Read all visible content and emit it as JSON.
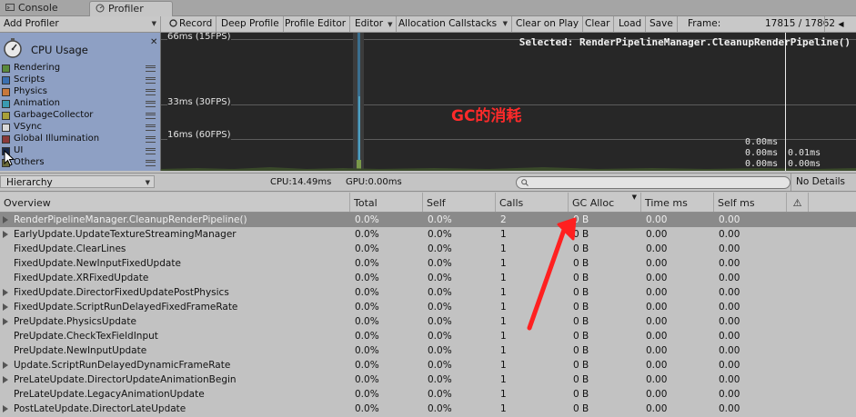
{
  "tabs": {
    "console": "Console",
    "profiler": "Profiler"
  },
  "toolbar": {
    "add_profiler": "Add Profiler",
    "record": "Record",
    "deep_profile": "Deep Profile",
    "profile_editor": "Profile Editor",
    "editor": "Editor",
    "allocation_callstacks": "Allocation Callstacks",
    "clear_on_play": "Clear on Play",
    "clear": "Clear",
    "load": "Load",
    "save": "Save",
    "frame_label": "Frame:",
    "frame_value": "17815 / 17862"
  },
  "cpu_panel": {
    "title": "CPU Usage",
    "legend": [
      {
        "label": "Rendering",
        "color": "#5a8a3c"
      },
      {
        "label": "Scripts",
        "color": "#3a6fb0"
      },
      {
        "label": "Physics",
        "color": "#c8783a"
      },
      {
        "label": "Animation",
        "color": "#3a9ab0"
      },
      {
        "label": "GarbageCollector",
        "color": "#a8a03a"
      },
      {
        "label": "VSync",
        "color": "#d8d8d8"
      },
      {
        "label": "Global Illumination",
        "color": "#8a3a3a"
      },
      {
        "label": "UI",
        "color": "#1a2a4a"
      },
      {
        "label": "Others",
        "color": "#6a6a3a"
      }
    ]
  },
  "graph": {
    "labels": [
      "66ms (15FPS)",
      "33ms (30FPS)",
      "16ms (60FPS)"
    ],
    "selected": "Selected: RenderPipelineManager.CleanupRenderPipeline()",
    "annotation": "GC的消耗",
    "values_left": [
      "0.00ms",
      "0.00ms",
      "0.00ms"
    ],
    "values_right": [
      "0.01ms",
      "0.00ms"
    ]
  },
  "details_bar": {
    "view": "Hierarchy",
    "cpu": "CPU:14.49ms",
    "gpu": "GPU:0.00ms",
    "search_placeholder": "",
    "no_details": "No Details"
  },
  "table": {
    "columns": [
      "Overview",
      "Total",
      "Self",
      "Calls",
      "GC Alloc",
      "Time ms",
      "Self ms",
      "⚠"
    ],
    "rows": [
      {
        "name": "RenderPipelineManager.CleanupRenderPipeline()",
        "total": "0.0%",
        "self": "0.0%",
        "calls": "2",
        "gc": "0 B",
        "time": "0.00",
        "selfms": "0.00",
        "expand": true,
        "selected": true
      },
      {
        "name": "EarlyUpdate.UpdateTextureStreamingManager",
        "total": "0.0%",
        "self": "0.0%",
        "calls": "1",
        "gc": "0 B",
        "time": "0.00",
        "selfms": "0.00",
        "expand": true
      },
      {
        "name": "FixedUpdate.ClearLines",
        "total": "0.0%",
        "self": "0.0%",
        "calls": "1",
        "gc": "0 B",
        "time": "0.00",
        "selfms": "0.00",
        "expand": false
      },
      {
        "name": "FixedUpdate.NewInputFixedUpdate",
        "total": "0.0%",
        "self": "0.0%",
        "calls": "1",
        "gc": "0 B",
        "time": "0.00",
        "selfms": "0.00",
        "expand": false
      },
      {
        "name": "FixedUpdate.XRFixedUpdate",
        "total": "0.0%",
        "self": "0.0%",
        "calls": "1",
        "gc": "0 B",
        "time": "0.00",
        "selfms": "0.00",
        "expand": false
      },
      {
        "name": "FixedUpdate.DirectorFixedUpdatePostPhysics",
        "total": "0.0%",
        "self": "0.0%",
        "calls": "1",
        "gc": "0 B",
        "time": "0.00",
        "selfms": "0.00",
        "expand": true
      },
      {
        "name": "FixedUpdate.ScriptRunDelayedFixedFrameRate",
        "total": "0.0%",
        "self": "0.0%",
        "calls": "1",
        "gc": "0 B",
        "time": "0.00",
        "selfms": "0.00",
        "expand": true
      },
      {
        "name": "PreUpdate.PhysicsUpdate",
        "total": "0.0%",
        "self": "0.0%",
        "calls": "1",
        "gc": "0 B",
        "time": "0.00",
        "selfms": "0.00",
        "expand": true
      },
      {
        "name": "PreUpdate.CheckTexFieldInput",
        "total": "0.0%",
        "self": "0.0%",
        "calls": "1",
        "gc": "0 B",
        "time": "0.00",
        "selfms": "0.00",
        "expand": false
      },
      {
        "name": "PreUpdate.NewInputUpdate",
        "total": "0.0%",
        "self": "0.0%",
        "calls": "1",
        "gc": "0 B",
        "time": "0.00",
        "selfms": "0.00",
        "expand": false
      },
      {
        "name": "Update.ScriptRunDelayedDynamicFrameRate",
        "total": "0.0%",
        "self": "0.0%",
        "calls": "1",
        "gc": "0 B",
        "time": "0.00",
        "selfms": "0.00",
        "expand": true
      },
      {
        "name": "PreLateUpdate.DirectorUpdateAnimationBegin",
        "total": "0.0%",
        "self": "0.0%",
        "calls": "1",
        "gc": "0 B",
        "time": "0.00",
        "selfms": "0.00",
        "expand": true
      },
      {
        "name": "PreLateUpdate.LegacyAnimationUpdate",
        "total": "0.0%",
        "self": "0.0%",
        "calls": "1",
        "gc": "0 B",
        "time": "0.00",
        "selfms": "0.00",
        "expand": false
      },
      {
        "name": "PostLateUpdate.DirectorLateUpdate",
        "total": "0.0%",
        "self": "0.0%",
        "calls": "1",
        "gc": "0 B",
        "time": "0.00",
        "selfms": "0.00",
        "expand": true
      }
    ]
  }
}
